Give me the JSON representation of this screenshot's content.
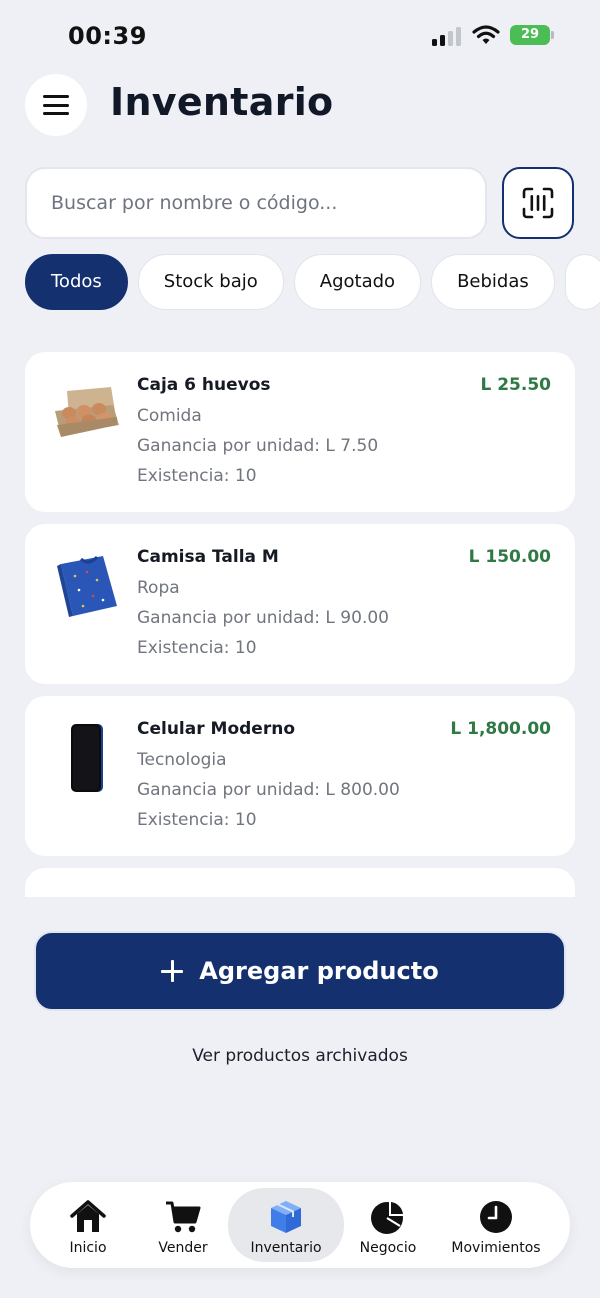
{
  "status_bar": {
    "time": "00:39",
    "battery": "29"
  },
  "header": {
    "title": "Inventario",
    "menu_icon": "hamburger-icon"
  },
  "search": {
    "placeholder": "Buscar por nombre o código...",
    "value": "",
    "scan_icon": "barcode-scan-icon"
  },
  "filters": [
    {
      "label": "Todos",
      "active": true
    },
    {
      "label": "Stock bajo",
      "active": false
    },
    {
      "label": "Agotado",
      "active": false
    },
    {
      "label": "Bebidas",
      "active": false
    }
  ],
  "products": [
    {
      "name": "Caja 6 huevos",
      "category": "Comida",
      "profit": "Ganancia por unidad: L 7.50",
      "stock": "Existencia: 10",
      "price": "L 25.50",
      "image": "egg-carton"
    },
    {
      "name": "Camisa Talla M",
      "category": "Ropa",
      "profit": "Ganancia por unidad: L 90.00",
      "stock": "Existencia: 10",
      "price": "L 150.00",
      "image": "blue-shirt"
    },
    {
      "name": "Celular Moderno",
      "category": "Tecnologia",
      "profit": "Ganancia por unidad: L 800.00",
      "stock": "Existencia: 10",
      "price": "L 1,800.00",
      "image": "smartphone"
    }
  ],
  "actions": {
    "add_label": "Agregar producto",
    "archived_label": "Ver productos archivados"
  },
  "nav": {
    "items": [
      {
        "label": "Inicio",
        "icon": "home-icon"
      },
      {
        "label": "Vender",
        "icon": "cart-icon"
      },
      {
        "label": "Inventario",
        "icon": "box-icon",
        "active": true
      },
      {
        "label": "Negocio",
        "icon": "pie-chart-icon"
      },
      {
        "label": "Movimientos",
        "icon": "clock-icon"
      }
    ]
  },
  "colors": {
    "primary": "#14306f",
    "price": "#2f7a44",
    "background": "#eef0f5",
    "battery": "#4cbd54",
    "nav_active_icon": "#3f7ee8"
  }
}
